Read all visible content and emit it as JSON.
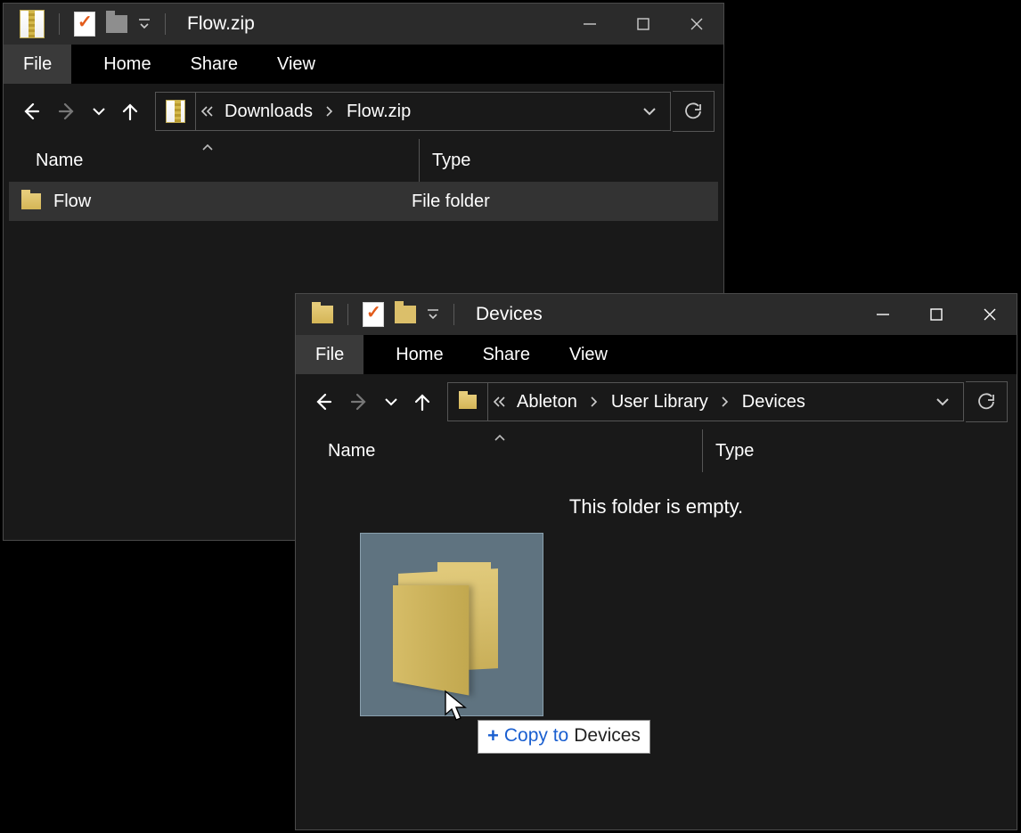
{
  "window1": {
    "title": "Flow.zip",
    "tabs": {
      "file": "File",
      "home": "Home",
      "share": "Share",
      "view": "View"
    },
    "breadcrumb": [
      "Downloads",
      "Flow.zip"
    ],
    "columns": {
      "name": "Name",
      "type": "Type"
    },
    "row": {
      "name": "Flow",
      "type": "File folder"
    }
  },
  "window2": {
    "title": "Devices",
    "tabs": {
      "file": "File",
      "home": "Home",
      "share": "Share",
      "view": "View"
    },
    "breadcrumb": [
      "Ableton",
      "User Library",
      "Devices"
    ],
    "columns": {
      "name": "Name",
      "type": "Type"
    },
    "empty_msg": "This folder is empty.",
    "drop_tip_prefix": "Copy to",
    "drop_tip_dest": "Devices"
  }
}
